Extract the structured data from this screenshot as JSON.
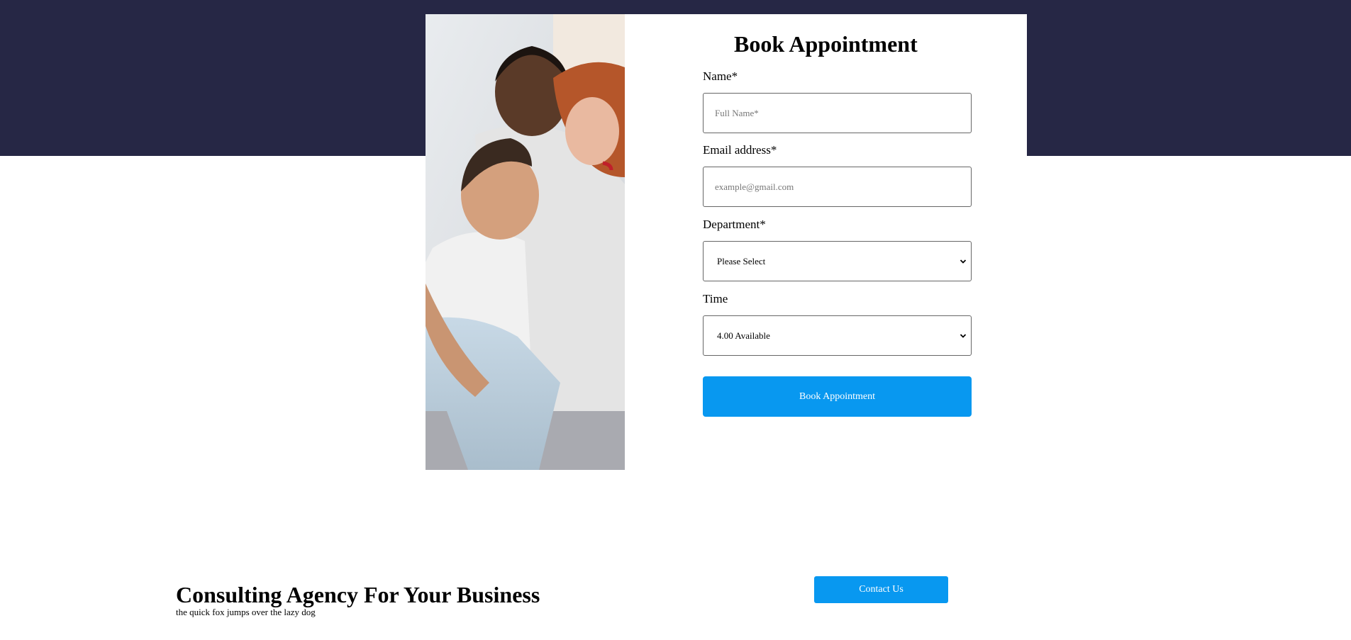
{
  "form": {
    "title": "Book Appointment",
    "name_label": "Name*",
    "name_placeholder": "Full Name*",
    "name_value": "",
    "email_label": "Email address*",
    "email_placeholder": "example@gmail.com",
    "email_value": "",
    "department_label": "Department*",
    "department_selected": "Please Select",
    "time_label": "Time",
    "time_selected": "4.00 Available",
    "submit_label": "Book Appointment"
  },
  "photo": {
    "icon": "family-photo",
    "description": ""
  },
  "footer": {
    "title": "Consulting Agency For Your Business",
    "subtitle": "the quick fox jumps over the lazy dog",
    "contact_label": "Contact Us"
  },
  "colors": {
    "hero_band": "#262745",
    "accent_button": "#0898f0",
    "card_background": "#ffffff"
  },
  "icons": {
    "select_arrow": "chevron-down-icon"
  }
}
